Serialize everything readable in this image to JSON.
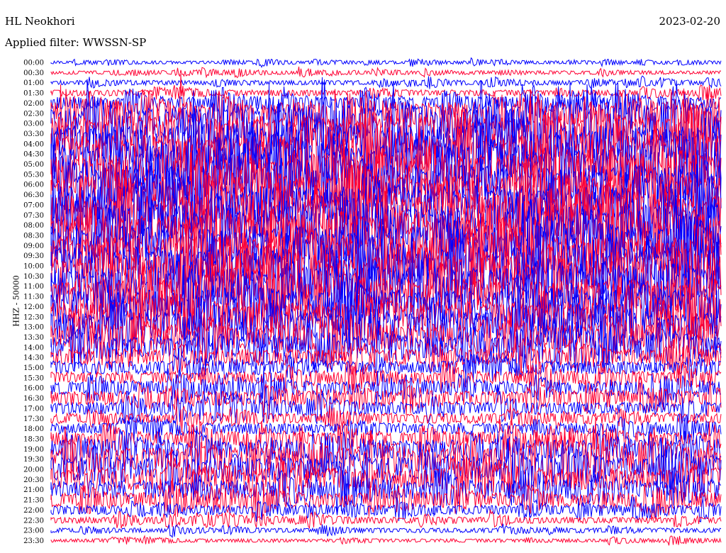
{
  "header": {
    "station": "HL Neokhori",
    "date": "2023-02-20",
    "filter": "Applied filter: WWSSN-SP"
  },
  "chart_data": {
    "type": "line",
    "ylabel": "HHZ - 50000",
    "colors": [
      "#0000ff",
      "#ff0033"
    ],
    "rows": [
      {
        "label": "00:00",
        "amp": 0.3
      },
      {
        "label": "00:30",
        "amp": 0.35
      },
      {
        "label": "01:00",
        "amp": 0.45
      },
      {
        "label": "01:30",
        "amp": 0.6
      },
      {
        "label": "02:00",
        "amp": 1.2
      },
      {
        "label": "02:30",
        "amp": 2.2
      },
      {
        "label": "03:00",
        "amp": 3.0
      },
      {
        "label": "03:30",
        "amp": 3.4
      },
      {
        "label": "04:00",
        "amp": 3.6
      },
      {
        "label": "04:30",
        "amp": 3.7
      },
      {
        "label": "05:00",
        "amp": 3.8
      },
      {
        "label": "05:30",
        "amp": 3.8
      },
      {
        "label": "06:00",
        "amp": 3.8
      },
      {
        "label": "06:30",
        "amp": 3.8
      },
      {
        "label": "07:00",
        "amp": 3.8
      },
      {
        "label": "07:30",
        "amp": 3.8
      },
      {
        "label": "08:00",
        "amp": 3.8
      },
      {
        "label": "08:30",
        "amp": 3.8
      },
      {
        "label": "09:00",
        "amp": 3.8
      },
      {
        "label": "09:30",
        "amp": 3.8
      },
      {
        "label": "10:00",
        "amp": 3.8
      },
      {
        "label": "10:30",
        "amp": 3.8
      },
      {
        "label": "11:00",
        "amp": 3.6
      },
      {
        "label": "11:30",
        "amp": 3.4
      },
      {
        "label": "12:00",
        "amp": 3.2
      },
      {
        "label": "12:30",
        "amp": 3.0
      },
      {
        "label": "13:00",
        "amp": 2.8
      },
      {
        "label": "13:30",
        "amp": 2.4
      },
      {
        "label": "14:00",
        "amp": 2.0
      },
      {
        "label": "14:30",
        "amp": 1.6
      },
      {
        "label": "15:00",
        "amp": 1.3
      },
      {
        "label": "15:30",
        "amp": 1.2
      },
      {
        "label": "16:00",
        "amp": 1.3
      },
      {
        "label": "16:30",
        "amp": 1.4
      },
      {
        "label": "17:00",
        "amp": 1.2
      },
      {
        "label": "17:30",
        "amp": 1.0
      },
      {
        "label": "18:00",
        "amp": 1.1
      },
      {
        "label": "18:30",
        "amp": 1.3
      },
      {
        "label": "19:00",
        "amp": 1.8
      },
      {
        "label": "19:30",
        "amp": 2.2
      },
      {
        "label": "20:00",
        "amp": 2.4
      },
      {
        "label": "20:30",
        "amp": 2.2
      },
      {
        "label": "21:00",
        "amp": 1.8
      },
      {
        "label": "21:30",
        "amp": 1.4
      },
      {
        "label": "22:00",
        "amp": 0.9
      },
      {
        "label": "22:30",
        "amp": 0.6
      },
      {
        "label": "23:00",
        "amp": 0.45
      },
      {
        "label": "23:30",
        "amp": 0.35
      }
    ]
  }
}
